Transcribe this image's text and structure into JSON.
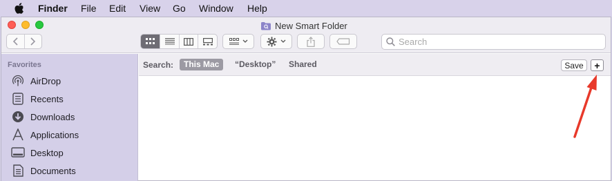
{
  "menubar": {
    "items": [
      "Finder",
      "File",
      "Edit",
      "View",
      "Go",
      "Window",
      "Help"
    ]
  },
  "window": {
    "title": "New Smart Folder",
    "search_placeholder": "Search"
  },
  "sidebar": {
    "heading": "Favorites",
    "items": [
      {
        "label": "AirDrop",
        "icon": "airdrop-icon"
      },
      {
        "label": "Recents",
        "icon": "clock-icon"
      },
      {
        "label": "Downloads",
        "icon": "download-icon"
      },
      {
        "label": "Applications",
        "icon": "applications-icon"
      },
      {
        "label": "Desktop",
        "icon": "desktop-icon"
      },
      {
        "label": "Documents",
        "icon": "documents-icon"
      }
    ]
  },
  "scopebar": {
    "label": "Search:",
    "scopes": [
      "This Mac",
      "“Desktop”",
      "Shared"
    ],
    "active_scope": "This Mac",
    "save_label": "Save",
    "add_label": "+"
  },
  "colors": {
    "annotation_arrow": "#e8392a",
    "sidebar_bg": "#d4cfe8",
    "menubar_bg": "#d8d2ea"
  }
}
